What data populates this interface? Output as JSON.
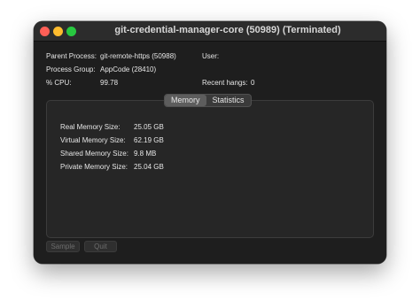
{
  "window": {
    "title": "git-credential-manager-core (50989) (Terminated)"
  },
  "info": {
    "parent_process_label": "Parent Process:",
    "parent_process_value": "git-remote-https (50988)",
    "user_label": "User:",
    "user_value": "",
    "process_group_label": "Process Group:",
    "process_group_value": "AppCode (28410)",
    "cpu_label": "% CPU:",
    "cpu_value": "99.78",
    "recent_hangs_label": "Recent hangs:",
    "recent_hangs_value": "0"
  },
  "tabs": [
    {
      "label": "Memory",
      "active": true
    },
    {
      "label": "Statistics",
      "active": false
    }
  ],
  "memory": [
    {
      "label": "Real Memory Size:",
      "value": "25.05 GB"
    },
    {
      "label": "Virtual Memory Size:",
      "value": "62.19 GB"
    },
    {
      "label": "Shared Memory Size:",
      "value": "9.8 MB"
    },
    {
      "label": "Private Memory Size:",
      "value": "25.04 GB"
    }
  ],
  "buttons": {
    "sample": "Sample",
    "quit": "Quit"
  }
}
